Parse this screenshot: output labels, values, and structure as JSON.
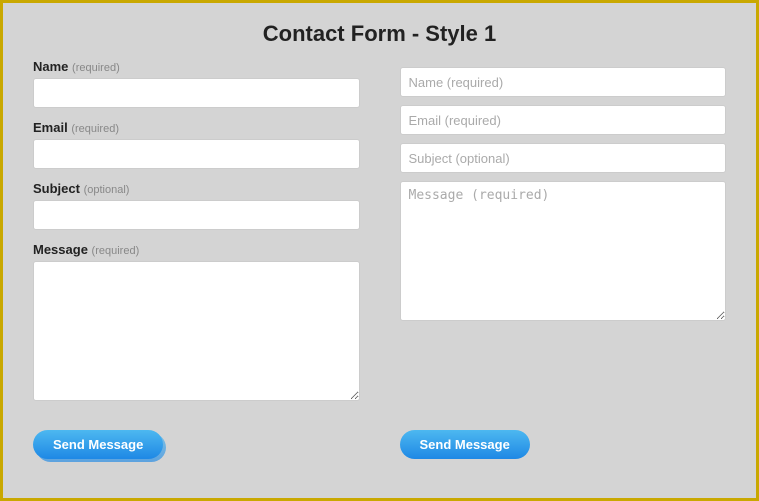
{
  "page": {
    "title": "Contact Form - Style 1",
    "border_color": "#c9a800",
    "background_color": "#d4d4d4"
  },
  "left_form": {
    "name_label": "Name",
    "name_required": "(required)",
    "name_placeholder": "",
    "email_label": "Email",
    "email_required": "(required)",
    "email_placeholder": "",
    "subject_label": "Subject",
    "subject_optional": "(optional)",
    "subject_placeholder": "",
    "message_label": "Message",
    "message_required": "(required)",
    "message_placeholder": "",
    "send_button": "Send Message"
  },
  "right_form": {
    "name_placeholder": "Name (required)",
    "email_placeholder": "Email (required)",
    "subject_placeholder": "Subject (optional)",
    "message_placeholder": "Message (required)",
    "send_button": "Send Message"
  }
}
